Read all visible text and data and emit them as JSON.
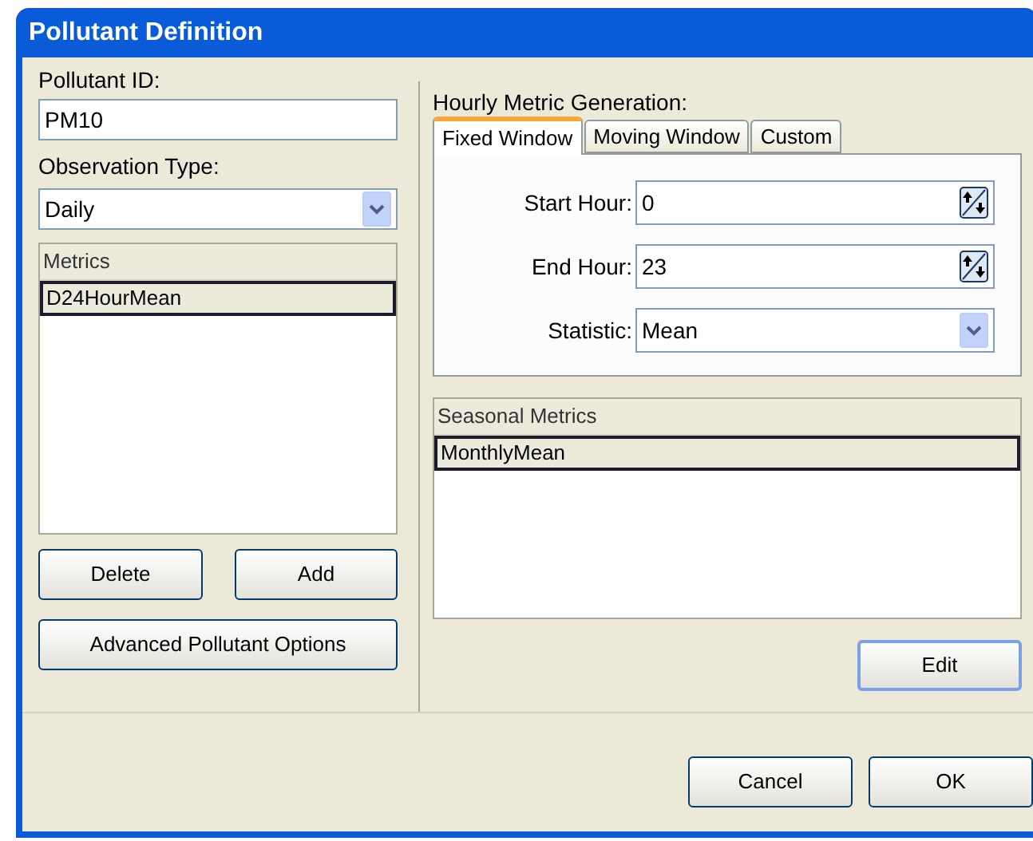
{
  "window": {
    "title": "Pollutant Definition"
  },
  "pollutant_id": {
    "label": "Pollutant ID:",
    "value": "PM10"
  },
  "observation_type": {
    "label": "Observation Type:",
    "value": "Daily"
  },
  "metrics": {
    "header": "Metrics",
    "items": [
      {
        "label": "D24HourMean",
        "selected": true
      }
    ]
  },
  "left_buttons": [
    "Delete",
    "Add"
  ],
  "advanced_button": "Advanced Pollutant Options",
  "hourly": {
    "label": "Hourly Metric Generation:",
    "tabs": [
      {
        "label": "Fixed Window",
        "selected": true
      },
      {
        "label": "Moving Window",
        "selected": false
      },
      {
        "label": "Custom",
        "selected": false
      }
    ],
    "fields": [
      {
        "kind": "spinner",
        "label": "Start Hour:",
        "value": "0"
      },
      {
        "kind": "spinner",
        "label": "End Hour:",
        "value": "23"
      },
      {
        "kind": "combo",
        "label": "Statistic:",
        "value": "Mean"
      }
    ]
  },
  "seasonal_metrics": {
    "header": "Seasonal Metrics",
    "items": [
      {
        "label": "MonthlyMean",
        "selected": true
      }
    ]
  },
  "edit_button": "Edit",
  "footer_buttons": [
    "Cancel",
    "OK"
  ]
}
